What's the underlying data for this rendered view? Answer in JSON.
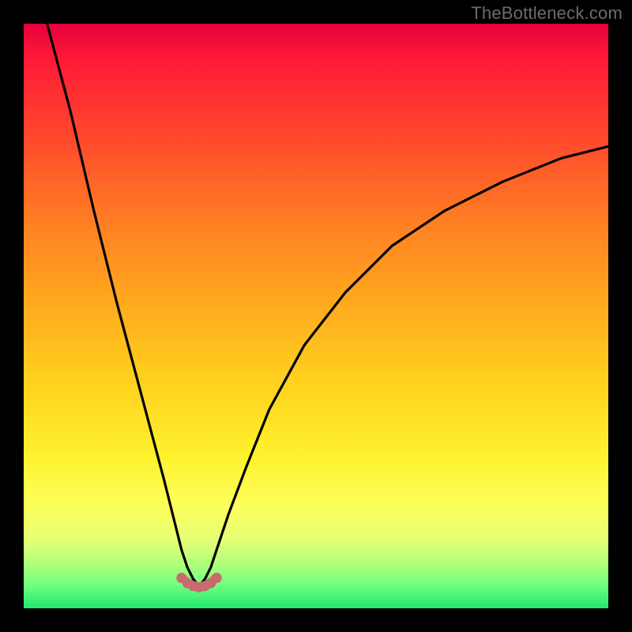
{
  "watermark": "TheBottleneck.com",
  "chart_data": {
    "type": "line",
    "title": "",
    "xlabel": "",
    "ylabel": "",
    "xlim": [
      0,
      100
    ],
    "ylim": [
      0,
      100
    ],
    "grid": false,
    "legend": false,
    "notes": "Two black curves on a vertical red→green gradient background. Curves plunge toward a common minimum near x≈30 and rise on either side. A short salmon-colored highlighted segment sits at the bottom of the valley (y≈3–5). Values estimated from pixel positions; no axis ticks or labels are shown.",
    "series": [
      {
        "name": "left-curve",
        "color": "#000000",
        "x": [
          4,
          8,
          12,
          16,
          20,
          24,
          26,
          27,
          28,
          29,
          30
        ],
        "values": [
          100,
          85,
          68,
          52,
          37,
          22,
          14,
          10,
          7,
          5,
          3.8
        ]
      },
      {
        "name": "right-curve",
        "color": "#000000",
        "x": [
          30,
          31,
          32,
          33,
          35,
          38,
          42,
          48,
          55,
          63,
          72,
          82,
          92,
          100
        ],
        "values": [
          3.8,
          5,
          7,
          10,
          16,
          24,
          34,
          45,
          54,
          62,
          68,
          73,
          77,
          79
        ]
      },
      {
        "name": "highlight-valley",
        "color": "#cc6f72",
        "x": [
          27,
          28,
          29,
          30,
          31,
          32,
          33
        ],
        "values": [
          5.3,
          4.4,
          3.9,
          3.7,
          3.9,
          4.4,
          5.3
        ]
      }
    ],
    "highlight_points": {
      "color": "#c86a6e",
      "x": [
        27,
        28,
        29,
        30,
        31,
        32,
        33
      ],
      "values": [
        5.2,
        4.3,
        3.8,
        3.6,
        3.8,
        4.3,
        5.2
      ]
    },
    "background_gradient_stops": [
      {
        "pos": 0.0,
        "color": "#e6003a"
      },
      {
        "pos": 0.2,
        "color": "#ff4a2c"
      },
      {
        "pos": 0.48,
        "color": "#ffaa1e"
      },
      {
        "pos": 0.74,
        "color": "#fff22e"
      },
      {
        "pos": 0.92,
        "color": "#b6ff7a"
      },
      {
        "pos": 1.0,
        "color": "#20e86f"
      }
    ]
  }
}
